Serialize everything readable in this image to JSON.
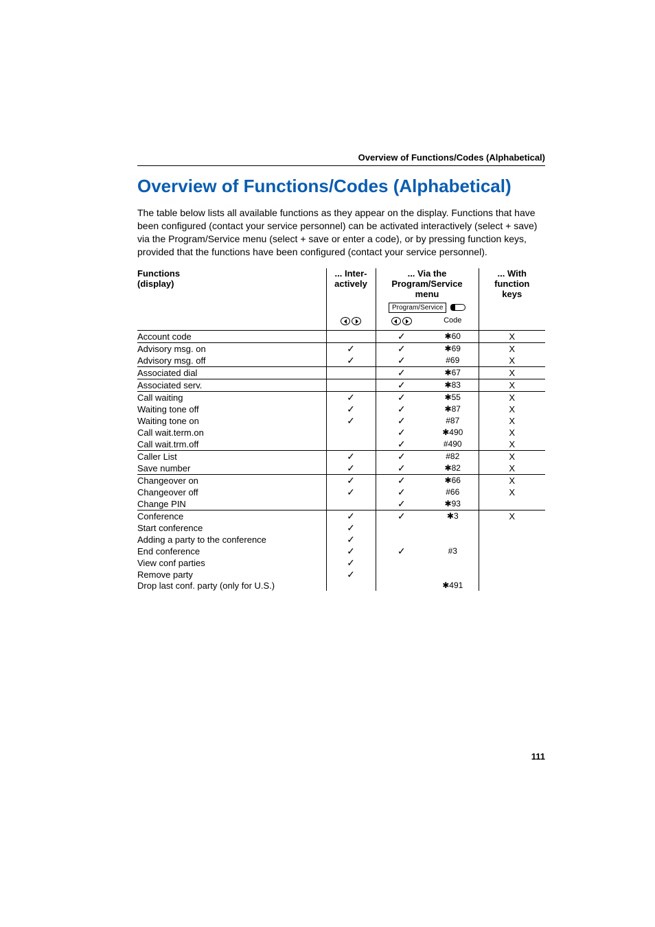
{
  "running_head": "Overview of Functions/Codes (Alphabetical)",
  "title": "Overview of Functions/Codes (Alphabetical)",
  "intro": "The table below lists all available functions as they appear on the display. Functions that have been configured (contact your service personnel) can be activated interactively (select + save) via the Program/Service menu (select + save or enter a code), or by pressing function keys, provided that the functions have been configured (contact your service personnel).",
  "headers": {
    "functions_l1": "Functions",
    "functions_l2": "(display)",
    "inter_pre": "... Inter-",
    "inter_l2": "actively",
    "via_pre": "... Via the",
    "via_l2": "Program/Service",
    "via_l3": "menu",
    "via_btn": "Program/Service",
    "with_pre": "... With",
    "with_l2": "function",
    "with_l3": "keys",
    "code": "Code"
  },
  "glyphs": {
    "check": "✓",
    "x": "X",
    "star": "✱"
  },
  "rows": [
    {
      "sep": true,
      "fn": "Account code",
      "inter": "",
      "nav": "c",
      "code": "*60",
      "with": "X"
    },
    {
      "sep": true,
      "fn": "Advisory msg. on",
      "inter": "c",
      "nav": "c",
      "code": "*69",
      "with": "X"
    },
    {
      "sep": false,
      "fn": "Advisory msg. off",
      "inter": "c",
      "nav": "c",
      "code": "#69",
      "with": "X"
    },
    {
      "sep": true,
      "fn": "Associated dial",
      "inter": "",
      "nav": "c",
      "code": "*67",
      "with": "X"
    },
    {
      "sep": true,
      "fn": "Associated serv.",
      "inter": "",
      "nav": "c",
      "code": "*83",
      "with": "X"
    },
    {
      "sep": true,
      "fn": "Call waiting",
      "inter": "c",
      "nav": "c",
      "code": "*55",
      "with": "X"
    },
    {
      "sep": false,
      "fn": "Waiting tone off",
      "inter": "c",
      "nav": "c",
      "code": "*87",
      "with": "X"
    },
    {
      "sep": false,
      "fn": "Waiting tone on",
      "inter": "c",
      "nav": "c",
      "code": "#87",
      "with": "X"
    },
    {
      "sep": false,
      "fn": "Call wait.term.on",
      "inter": "",
      "nav": "c",
      "code": "*490",
      "with": "X"
    },
    {
      "sep": false,
      "fn": "Call wait.trm.off",
      "inter": "",
      "nav": "c",
      "code": "#490",
      "with": "X"
    },
    {
      "sep": true,
      "fn": "Caller List",
      "inter": "c",
      "nav": "c",
      "code": "#82",
      "with": "X"
    },
    {
      "sep": false,
      "fn": "Save number",
      "inter": "c",
      "nav": "c",
      "code": "*82",
      "with": "X"
    },
    {
      "sep": true,
      "fn": "Changeover on",
      "inter": "c",
      "nav": "c",
      "code": "*66",
      "with": "X"
    },
    {
      "sep": false,
      "fn": "Changeover off",
      "inter": "c",
      "nav": "c",
      "code": "#66",
      "with": "X"
    },
    {
      "sep": false,
      "fn": "Change PIN",
      "inter": "",
      "nav": "c",
      "code": "*93",
      "with": ""
    },
    {
      "sep": true,
      "fn": "Conference",
      "inter": "c",
      "nav": "c",
      "code": "*3",
      "with": "X"
    },
    {
      "sep": false,
      "fn": "Start conference",
      "inter": "c",
      "nav": "",
      "code": "",
      "with": ""
    },
    {
      "sep": false,
      "fn": "Adding a party to the conference",
      "inter": "c",
      "nav": "",
      "code": "",
      "with": ""
    },
    {
      "sep": false,
      "fn": "End conference",
      "inter": "c",
      "nav": "c",
      "code": "#3",
      "with": ""
    },
    {
      "sep": false,
      "fn": "View conf parties",
      "inter": "c",
      "nav": "",
      "code": "",
      "with": ""
    },
    {
      "sep": false,
      "fn": "Remove party",
      "inter": "c",
      "nav": "",
      "code": "",
      "with": ""
    },
    {
      "sep": false,
      "fn": "Drop last conf. party (only for U.S.)",
      "inter": "",
      "nav": "",
      "code": "*491",
      "with": ""
    }
  ],
  "page_number": "111"
}
